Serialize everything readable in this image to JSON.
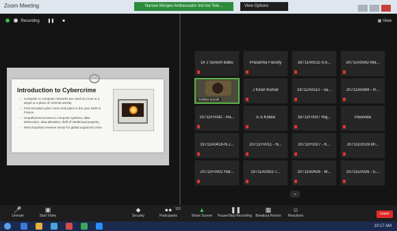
{
  "window": {
    "app_title": "Zoom Meeting",
    "banner_text": "Narsee Monjee Ambassador Ind Ind Tele...",
    "view_options": "View Options"
  },
  "meeting": {
    "recording_label": "Recording",
    "view_label": "View"
  },
  "slide": {
    "title": "Introduction to Cybercrime",
    "bullets": [
      "Computer or computer networks are used as a tool or a target or a place of criminal activity.",
      "First recorded cyber crime took place in the year 1820 in France.",
      "Unauthorized access to computer systems, data destruction, data alteration, theft of intellectual property.",
      "Most important revenue sector for global organized crime."
    ]
  },
  "participants": [
    {
      "name": "Dr J Suresh Babu",
      "video": false
    },
    {
      "name": "Prasanna Faculty",
      "video": false
    },
    {
      "name": "18711A0511-S.k...",
      "video": false
    },
    {
      "name": "20711A0562-Ma...",
      "video": false
    },
    {
      "name": "",
      "video": true,
      "video_label": "Kristina Suresh"
    },
    {
      "name": "J Kiran Kumar",
      "video": false
    },
    {
      "name": "19711A0512 - sa...",
      "video": false
    },
    {
      "name": "20711A0569 - R...",
      "video": false
    },
    {
      "name": "20711F0042 - Ra...",
      "video": false
    },
    {
      "name": "A.S.Kokila",
      "video": false
    },
    {
      "name": "18711F0037 Raj...",
      "video": false
    },
    {
      "name": "Pavenda",
      "video": false
    },
    {
      "name": "19711A0418-N.J...",
      "video": false
    },
    {
      "name": "20711F0011 - N...",
      "video": false
    },
    {
      "name": "20711F0027 - K...",
      "video": false
    },
    {
      "name": "20711E0019 kh...",
      "video": false
    },
    {
      "name": "20711F0002 Har...",
      "video": false
    },
    {
      "name": "19711A0302-T...",
      "video": false
    },
    {
      "name": "20711A0426 - M...",
      "video": false
    },
    {
      "name": "20711E0026 - E...",
      "video": false
    }
  ],
  "toolbar": {
    "unmute": "Unmute",
    "start_video": "Start Video",
    "security": "Security",
    "participants": "Participants",
    "participants_count": "101",
    "share_screen": "Share Screen",
    "pause_stop_recording": "Pause/Stop Recording",
    "breakout_rooms": "Breakout Rooms",
    "reactions": "Reactions",
    "end": "Leave"
  },
  "taskbar": {
    "clock": "10:17 AM"
  },
  "colors": {
    "banner_green": "#2e8b3c",
    "mute_red": "#e0342c",
    "end_red": "#e02a2a",
    "active_speaker_green": "#59b34a"
  },
  "icons": {
    "mic": "mic-muted-icon",
    "video": "video-off-icon",
    "security": "shield-icon",
    "participants": "people-icon",
    "share": "share-screen-icon",
    "record": "record-icon",
    "breakout": "grid-icon",
    "reactions": "smile-icon"
  }
}
